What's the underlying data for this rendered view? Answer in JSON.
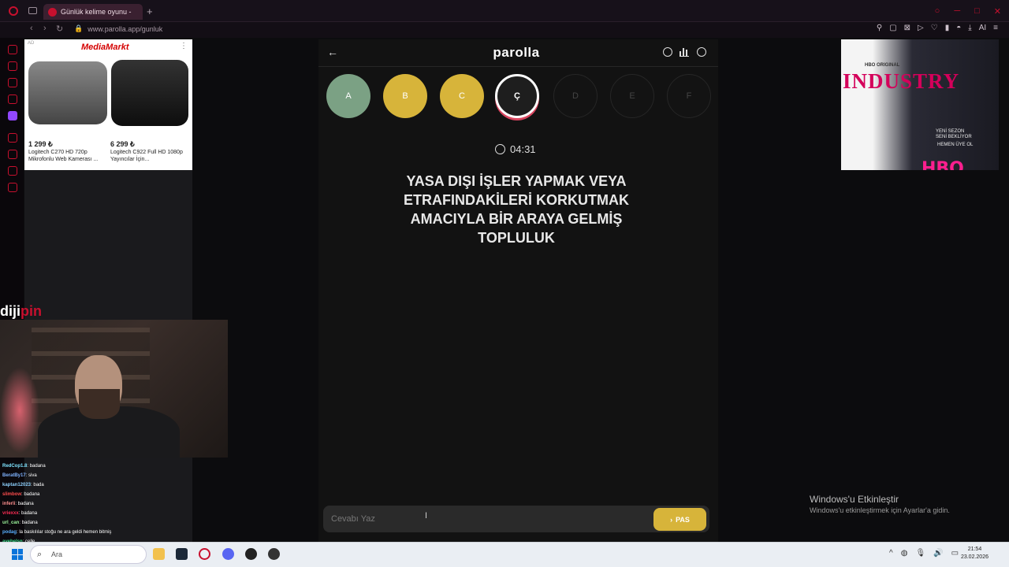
{
  "browser": {
    "tab_title": "Günlük kelime oyunu -",
    "url": "www.parolla.app/gunluk"
  },
  "ads": {
    "left": {
      "ad_label": "AD",
      "brand": "MediaMarkt",
      "products": [
        {
          "price": "1 299 ₺",
          "desc": "Logitech C270 HD 720p Mikrofonlu Web Kamerası ..."
        },
        {
          "price": "6 299 ₺",
          "desc": "Logitech C922 Full HD 1080p Yayıncılar İçin..."
        }
      ]
    },
    "right": {
      "badge": "HBO ORIGINAL",
      "title": "INDUSTRY",
      "line1": "YENİ SEZON",
      "line2": "SENİ BEKLİYOR",
      "line3": "HEMEN ÜYE OL",
      "brand": "HBO max"
    }
  },
  "game": {
    "logo": "parolla",
    "letters": [
      {
        "char": "A",
        "state": "correct"
      },
      {
        "char": "B",
        "state": "passed"
      },
      {
        "char": "C",
        "state": "passed"
      },
      {
        "char": "Ç",
        "state": "active"
      },
      {
        "char": "D",
        "state": "upcoming"
      },
      {
        "char": "E",
        "state": "upcoming"
      },
      {
        "char": "F",
        "state": "upcoming"
      }
    ],
    "timer": "04:31",
    "question": "YASA DIŞI İŞLER YAPMAK VEYA ETRAFINDAKİLERİ KORKUTMAK AMACIYLA BİR ARAYA GELMİŞ TOPLULUK",
    "answer_placeholder": "Cevabı Yaz",
    "pass_label": "PAS",
    "colors": {
      "correct": "#7ba184",
      "passed": "#d7b43a",
      "active_ring": "#d9455f"
    }
  },
  "stream": {
    "logo_text_a": "diji",
    "logo_text_b": "pin"
  },
  "chat": [
    {
      "user": "RedCop1.8",
      "msg": ": badana"
    },
    {
      "user": "BeratBy17",
      "msg": ": siva"
    },
    {
      "user": "kaptan12023",
      "msg": ": bada"
    },
    {
      "user": "slimbow",
      "msg": ": badana"
    },
    {
      "user": "inferli",
      "msg": ": badana"
    },
    {
      "user": "vriexxx",
      "msg": ": badana"
    },
    {
      "user": "url_can",
      "msg": ": badana"
    },
    {
      "user": "podag",
      "msg": ": la baskılılar stoğu ne ara geldi hemen bitmiş"
    },
    {
      "user": "avebelsn",
      "msg": ": celle"
    }
  ],
  "desktop": {
    "watermark_title": "Windows'u Etkinleştir",
    "watermark_sub": "Windows'u etkinleştirmek için Ayarlar'a gidin."
  },
  "taskbar": {
    "search_placeholder": "Ara",
    "time": "21:54",
    "date": "23.02.2026"
  }
}
